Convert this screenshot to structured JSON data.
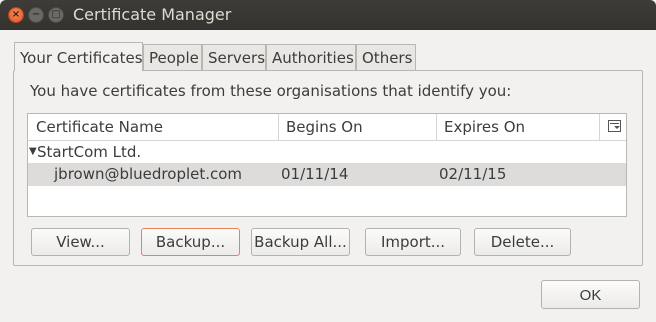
{
  "window": {
    "title": "Certificate Manager",
    "controls": {
      "close": "×",
      "minimize": "−",
      "maximize": "□"
    }
  },
  "tabs": [
    {
      "label": "Your Certificates",
      "active": true
    },
    {
      "label": "People",
      "active": false
    },
    {
      "label": "Servers",
      "active": false
    },
    {
      "label": "Authorities",
      "active": false
    },
    {
      "label": "Others",
      "active": false
    }
  ],
  "panel": {
    "intro": "You have certificates from these organisations that identify you:"
  },
  "table": {
    "columns": [
      "Certificate Name",
      "Begins On",
      "Expires On"
    ],
    "groups": [
      {
        "twisty": "▼",
        "name": "StartCom Ltd.",
        "rows": [
          {
            "name": "jbrown@bluedroplet.com",
            "begins": "01/11/14",
            "expires": "02/11/15",
            "selected": true
          }
        ]
      }
    ]
  },
  "buttons": {
    "view": "View...",
    "backup": "Backup...",
    "backup_all": "Backup All...",
    "import": "Import...",
    "delete": "Delete..."
  },
  "dialog": {
    "ok": "OK"
  },
  "colors": {
    "accent_focus": "#e8825a",
    "selected_row": "#dedcda",
    "titlebar": "#3d3c38"
  }
}
